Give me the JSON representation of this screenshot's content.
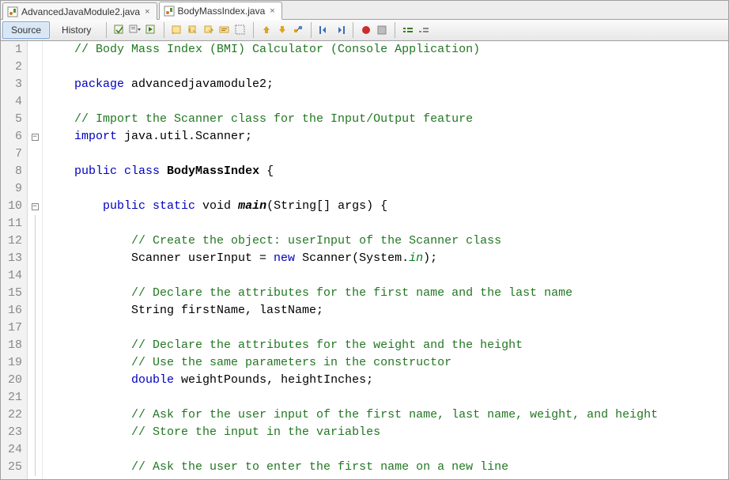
{
  "tabs": [
    {
      "label": "AdvancedJavaModule2.java",
      "active": false
    },
    {
      "label": "BodyMassIndex.java",
      "active": true
    }
  ],
  "view_tabs": {
    "source": "Source",
    "history": "History"
  },
  "toolbar_icons": [
    "last-edit-icon",
    "dropdown-icon",
    "forward-icon",
    "find-selection-icon",
    "find-prev-icon",
    "find-next-icon",
    "highlight-icon",
    "toggle-rect-icon",
    "prev-bookmark-icon",
    "next-bookmark-icon",
    "toggle-bookmark-icon",
    "shift-left-icon",
    "shift-right-icon",
    "macro-record-icon",
    "macro-stop-icon",
    "comment-icon",
    "uncomment-icon"
  ],
  "code": {
    "lines": 25,
    "l1": "    // Body Mass Index (BMI) Calculator (Console Application)",
    "l2": "",
    "l3a": "    ",
    "l3b": "package",
    "l3c": " advancedjavamodule2;",
    "l4": "",
    "l5": "    // Import the Scanner class for the Input/Output feature",
    "l6a": "    ",
    "l6b": "import",
    "l6c": " java.util.Scanner;",
    "l7": "",
    "l8a": "    ",
    "l8b": "public class ",
    "l8c": "BodyMassIndex",
    "l8d": " {",
    "l9": "",
    "l10a": "        ",
    "l10b": "public static ",
    "l10c": "void ",
    "l10d": "main",
    "l10e": "(String[] args) {",
    "l11": "",
    "l12": "            // Create the object: userInput of the Scanner class",
    "l13a": "            Scanner userInput = ",
    "l13b": "new",
    "l13c": " Scanner(System.",
    "l13d": "in",
    "l13e": ");",
    "l14": "",
    "l15": "            // Declare the attributes for the first name and the last name",
    "l16": "            String firstName, lastName;",
    "l17": "",
    "l18": "            // Declare the attributes for the weight and the height",
    "l19": "            // Use the same parameters in the constructor",
    "l20a": "            ",
    "l20b": "double",
    "l20c": " weightPounds, heightInches;",
    "l21": "",
    "l22": "            // Ask for the user input of the first name, last name, weight, and height",
    "l23": "            // Store the input in the variables",
    "l24": "",
    "l25": "            // Ask the user to enter the first name on a new line"
  }
}
